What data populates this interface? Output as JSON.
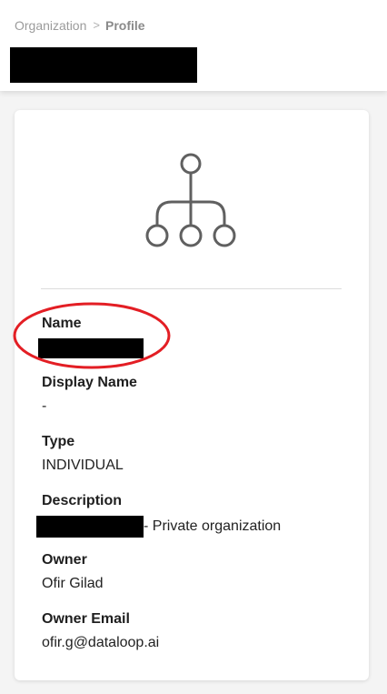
{
  "breadcrumb": {
    "parent": "Organization",
    "separator": ">",
    "current": "Profile"
  },
  "profile": {
    "icon": "organization-hierarchy-icon",
    "fields": {
      "name": {
        "label": "Name"
      },
      "display_name": {
        "label": "Display Name",
        "value": "-"
      },
      "type": {
        "label": "Type",
        "value": "INDIVIDUAL"
      },
      "description": {
        "label": "Description",
        "value_suffix": "- Private organization"
      },
      "owner": {
        "label": "Owner",
        "value": "Ofir Gilad"
      },
      "owner_email": {
        "label": "Owner Email",
        "value": "ofir.g@dataloop.ai"
      }
    }
  },
  "colors": {
    "annotation": "#e31e24",
    "icon": "#606060",
    "redaction": "#000000"
  }
}
